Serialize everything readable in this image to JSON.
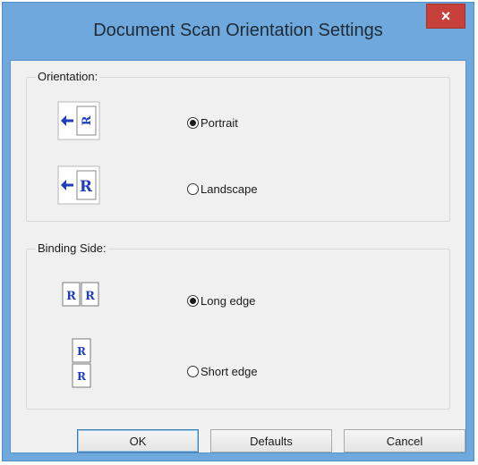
{
  "window": {
    "title": "Document Scan Orientation Settings",
    "close_label": "×"
  },
  "orientation": {
    "label": "Orientation:",
    "options": [
      {
        "label": "Portrait",
        "selected": true,
        "icon": "portrait-feed-icon"
      },
      {
        "label": "Landscape",
        "selected": false,
        "icon": "landscape-feed-icon"
      }
    ]
  },
  "binding": {
    "label": "Binding Side:",
    "options": [
      {
        "label": "Long edge",
        "selected": true,
        "icon": "long-edge-binding-icon"
      },
      {
        "label": "Short edge",
        "selected": false,
        "icon": "short-edge-binding-icon"
      }
    ]
  },
  "buttons": {
    "ok": "OK",
    "defaults": "Defaults",
    "cancel": "Cancel"
  },
  "colors": {
    "title_bar": "#6fa8dc",
    "close_button": "#c7413a",
    "icon_blue": "#1f3fbf",
    "client_bg": "#f0f0f0"
  }
}
